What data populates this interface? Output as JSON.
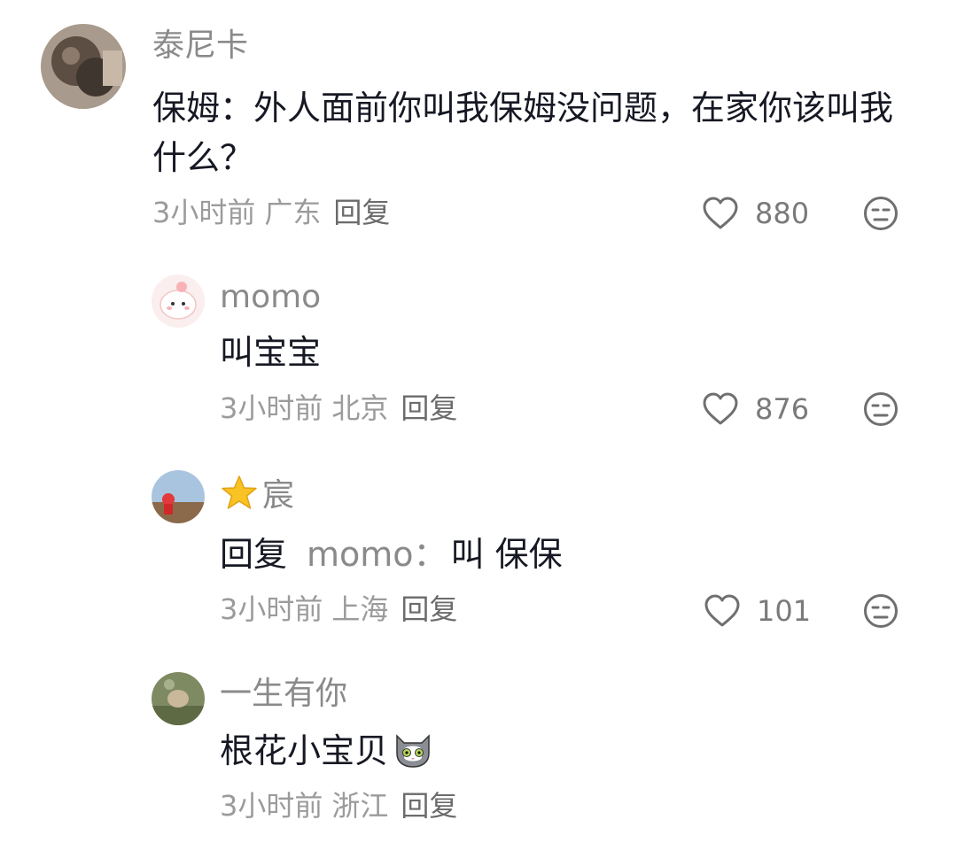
{
  "comments": [
    {
      "username": "泰尼卡",
      "text": "保姆：外人面前你叫我保姆没问题，在家你该叫我什么？",
      "time": "3小时前",
      "location": "广东",
      "reply_label": "回复",
      "likes": "880"
    },
    {
      "username": "momo",
      "text": "叫宝宝",
      "time": "3小时前",
      "location": "北京",
      "reply_label": "回复",
      "likes": "876"
    },
    {
      "username": "宸",
      "reply_prefix": "回复",
      "reply_to": "momo：",
      "text": "叫 保保",
      "time": "3小时前",
      "location": "上海",
      "reply_label": "回复",
      "likes": "101"
    },
    {
      "username": "一生有你",
      "text": "根花小宝贝",
      "time": "3小时前",
      "location": "浙江",
      "reply_label": "回复"
    }
  ],
  "colors": {
    "username": "#8a8a8a",
    "text": "#161823",
    "meta": "#9b9b9b",
    "icon": "#6f6f6f"
  }
}
